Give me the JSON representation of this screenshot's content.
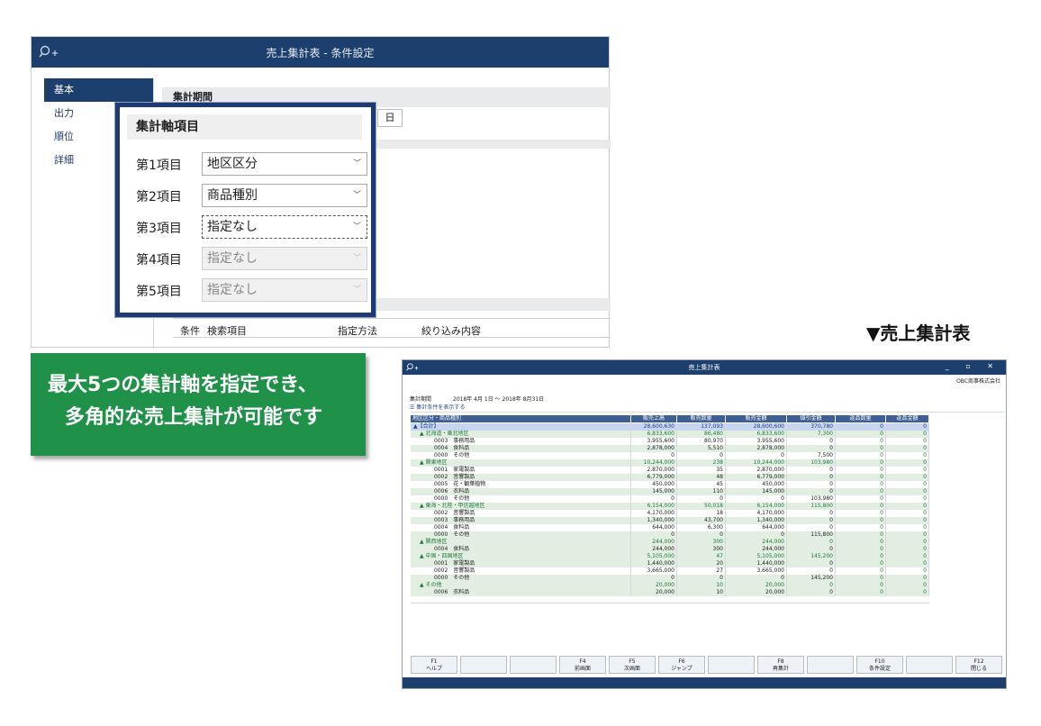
{
  "window1": {
    "title": "売上集計表 - 条件設定",
    "sidebar": [
      "基本",
      "出力",
      "順位",
      "詳細"
    ],
    "section_period": "集計期間",
    "date_fragment": "日",
    "filter_headers": [
      "条件",
      "検索項目",
      "指定方法",
      "絞り込み内容"
    ]
  },
  "popup": {
    "title": "集計軸項目",
    "rows": [
      {
        "label": "第1項目",
        "value": "地区区分",
        "state": "normal"
      },
      {
        "label": "第2項目",
        "value": "商品種別",
        "state": "normal"
      },
      {
        "label": "第3項目",
        "value": "指定なし",
        "state": "focused"
      },
      {
        "label": "第4項目",
        "value": "指定なし",
        "state": "disabled"
      },
      {
        "label": "第5項目",
        "value": "指定なし",
        "state": "disabled"
      }
    ]
  },
  "callout": {
    "line1": "最大5つの集計軸を指定でき、",
    "line2": "多角的な売上集計が可能です"
  },
  "label": "▼売上集計表",
  "window2": {
    "title": "売上集計表",
    "controls": "_ ▫ ✕",
    "company": "OBC商事株式会社",
    "period_label": "集計期間",
    "period_value": "2018年 4月 1日 ～ 2018年 8月31日",
    "condition_toggle": "集計条件を表示する",
    "columns": [
      "地区区分・商品種別",
      "販売上高",
      "販売数量",
      "販売金額",
      "値引金額",
      "返品数量",
      "返品金額"
    ],
    "rows": [
      {
        "name": "▲【合計】",
        "type": "total",
        "vals": [
          "28,600,630",
          "137,093",
          "28,600,600",
          "370,780",
          "0",
          "0"
        ]
      },
      {
        "name": "▲ 北海道・東北地区",
        "type": "grp",
        "vals": [
          "6,833,600",
          "86,480",
          "6,833,600",
          "7,300",
          "0",
          "0"
        ]
      },
      {
        "name": "0003　事務用品",
        "type": "item",
        "vals": [
          "3,955,600",
          "80,970",
          "3,955,600",
          "0",
          "0",
          "0"
        ]
      },
      {
        "name": "0004　食料品",
        "type": "item",
        "vals": [
          "2,878,000",
          "5,510",
          "2,878,000",
          "0",
          "0",
          "0"
        ]
      },
      {
        "name": "0000　その他",
        "type": "item",
        "vals": [
          "0",
          "0",
          "0",
          "7,500",
          "0",
          "0"
        ]
      },
      {
        "name": "▲ 関東地区",
        "type": "grp",
        "vals": [
          "10,244,000",
          "238",
          "10,244,000",
          "103,980",
          "0",
          "0"
        ]
      },
      {
        "name": "0001　家電製品",
        "type": "item",
        "vals": [
          "2,870,000",
          "35",
          "2,870,000",
          "0",
          "0",
          "0"
        ]
      },
      {
        "name": "0002　音響製品",
        "type": "item",
        "vals": [
          "6,779,000",
          "48",
          "6,779,000",
          "0",
          "0",
          "0"
        ]
      },
      {
        "name": "0005　花・観葉植物",
        "type": "item",
        "vals": [
          "450,000",
          "45",
          "450,000",
          "0",
          "0",
          "0"
        ]
      },
      {
        "name": "0006　衣料品",
        "type": "item",
        "vals": [
          "145,000",
          "110",
          "145,000",
          "0",
          "0",
          "0"
        ]
      },
      {
        "name": "0000　その他",
        "type": "item",
        "vals": [
          "0",
          "0",
          "0",
          "103,980",
          "0",
          "0"
        ]
      },
      {
        "name": "▲ 東海・北陸・甲信越地区",
        "type": "grp",
        "vals": [
          "6,154,000",
          "50,018",
          "6,154,000",
          "115,800",
          "0",
          "0"
        ]
      },
      {
        "name": "0002　音響製品",
        "type": "item",
        "vals": [
          "4,170,000",
          "18",
          "4,170,000",
          "0",
          "0",
          "0"
        ]
      },
      {
        "name": "0003　事務用品",
        "type": "item",
        "vals": [
          "1,340,000",
          "43,700",
          "1,340,000",
          "0",
          "0",
          "0"
        ]
      },
      {
        "name": "0004　食料品",
        "type": "item",
        "vals": [
          "644,000",
          "6,300",
          "644,000",
          "0",
          "0",
          "0"
        ]
      },
      {
        "name": "0000　その他",
        "type": "item",
        "vals": [
          "0",
          "0",
          "0",
          "115,800",
          "0",
          "0"
        ]
      },
      {
        "name": "▲ 関西地区",
        "type": "grp",
        "vals": [
          "244,000",
          "300",
          "244,000",
          "0",
          "0",
          "0"
        ]
      },
      {
        "name": "0004　食料品",
        "type": "item",
        "vals": [
          "244,000",
          "300",
          "244,000",
          "0",
          "0",
          "0"
        ]
      },
      {
        "name": "▲ 中国・四国地区",
        "type": "grp",
        "vals": [
          "5,105,000",
          "47",
          "5,105,000",
          "145,200",
          "0",
          "0"
        ]
      },
      {
        "name": "0001　家電製品",
        "type": "item",
        "vals": [
          "1,440,000",
          "20",
          "1,440,000",
          "0",
          "0",
          "0"
        ]
      },
      {
        "name": "0002　音響製品",
        "type": "item",
        "vals": [
          "3,665,000",
          "27",
          "3,665,000",
          "0",
          "0",
          "0"
        ]
      },
      {
        "name": "0000　その他",
        "type": "item",
        "vals": [
          "0",
          "0",
          "0",
          "145,200",
          "0",
          "0"
        ]
      },
      {
        "name": "▲ その他",
        "type": "grp",
        "vals": [
          "20,000",
          "10",
          "20,000",
          "0",
          "0",
          "0"
        ]
      },
      {
        "name": "0006　衣料品",
        "type": "item",
        "vals": [
          "20,000",
          "10",
          "20,000",
          "0",
          "0",
          "0"
        ]
      }
    ],
    "fkeys": [
      {
        "key": "F1",
        "label": "ヘルプ"
      },
      {
        "key": "",
        "label": ""
      },
      {
        "key": "",
        "label": ""
      },
      {
        "key": "F4",
        "label": "前画面"
      },
      {
        "key": "F5",
        "label": "次画面"
      },
      {
        "key": "F6",
        "label": "ジャンプ"
      },
      {
        "key": "",
        "label": ""
      },
      {
        "key": "F8",
        "label": "再集計"
      },
      {
        "key": "",
        "label": ""
      },
      {
        "key": "F10",
        "label": "条件設定"
      },
      {
        "key": "",
        "label": ""
      },
      {
        "key": "F12",
        "label": "閉じる"
      }
    ]
  }
}
